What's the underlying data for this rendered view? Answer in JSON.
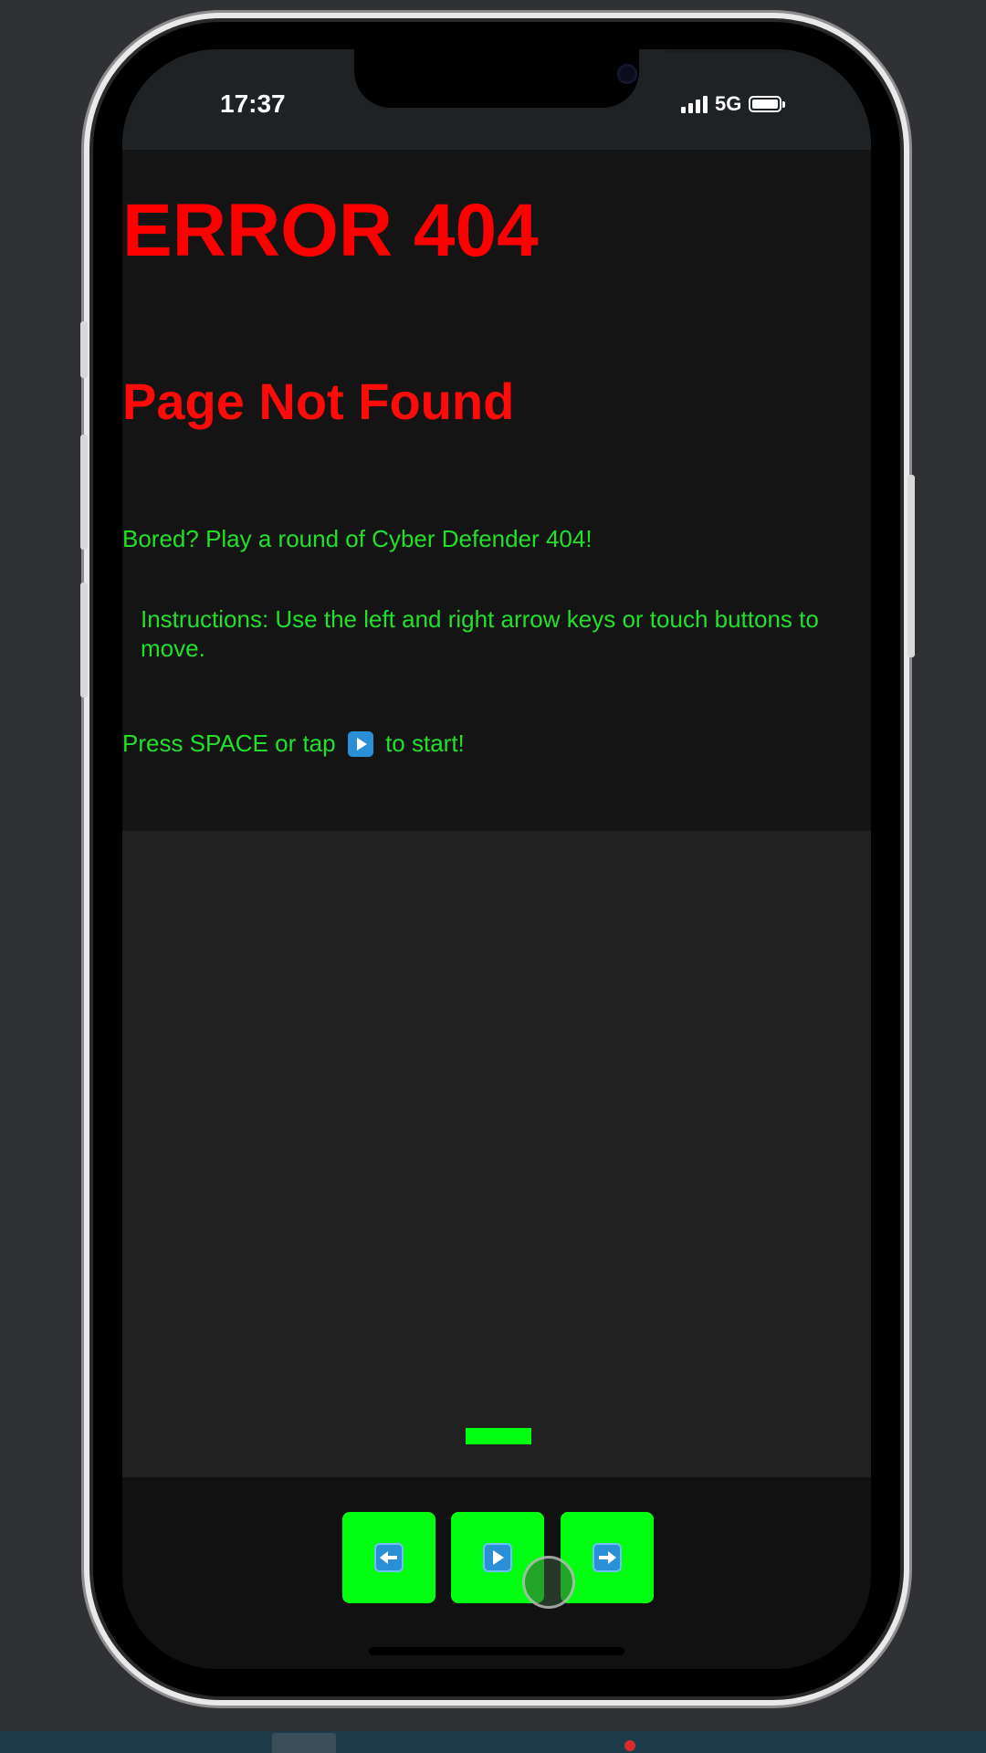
{
  "status_bar": {
    "time": "17:37",
    "network": "5G",
    "signal_icon": "signal-bars-icon",
    "battery_icon": "battery-icon"
  },
  "page": {
    "title": "ERROR 404",
    "subtitle": "Page Not Found",
    "bored_text": "Bored? Play a round of Cyber Defender 404!",
    "instructions": "Instructions: Use the left and right arrow keys or touch buttons to move.",
    "start_prefix": "Press SPACE or tap",
    "start_icon": "play-button-icon",
    "start_suffix": "to start!"
  },
  "controls": {
    "left": "left-arrow-icon",
    "play": "play-button-icon",
    "right": "right-arrow-icon"
  },
  "colors": {
    "error_red": "#ff0000",
    "text_green": "#22e02a",
    "button_green": "#00ff11",
    "key_blue": "#2a8fd6"
  }
}
